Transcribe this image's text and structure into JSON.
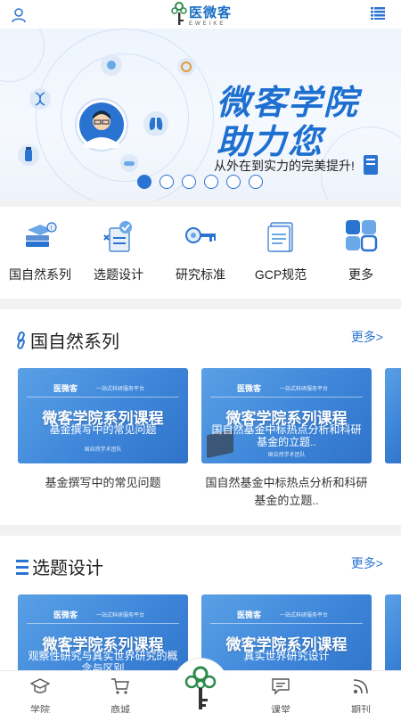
{
  "header": {
    "logo_text": "医微客",
    "logo_sub": "EWEIKE"
  },
  "banner": {
    "title_line1": "微客学院",
    "title_line2": "助力您",
    "subtitle": "从外在到实力的完美提升!",
    "slides_total": 6,
    "active_slide": 1
  },
  "quick_entries": [
    {
      "label": "国自然系列",
      "icon": "database-coins-icon"
    },
    {
      "label": "选题设计",
      "icon": "checklist-icon"
    },
    {
      "label": "研究标准",
      "icon": "key-icon"
    },
    {
      "label": "GCP规范",
      "icon": "document-gcp-icon"
    },
    {
      "label": "更多",
      "icon": "grid-more-icon"
    }
  ],
  "sections": [
    {
      "title": "国自然系列",
      "more": "更多>",
      "cards": [
        {
          "brand": "医微客",
          "tagline": "一站式科研服务平台",
          "course": "微客学院系列课程",
          "topic": "基金撰写中的常见问题",
          "team": "国自然学术团队",
          "caption": "基金撰写中的常见问题"
        },
        {
          "brand": "医微客",
          "tagline": "一站式科研服务平台",
          "course": "微客学院系列课程",
          "topic": "国自然基金中标热点分析和科研基金的立题..",
          "team": "国自然学术团队",
          "caption": "国自然基金中标热点分析和科研基金的立题.."
        }
      ]
    },
    {
      "title": "选题设计",
      "more": "更多>",
      "cards": [
        {
          "brand": "医微客",
          "tagline": "一站式科研服务平台",
          "course": "微客学院系列课程",
          "topic": "观察性研究与真实世界研究的概念与区别"
        },
        {
          "brand": "医微客",
          "tagline": "一站式科研服务平台",
          "course": "微客学院系列课程",
          "topic": "真实世界研究设计"
        }
      ]
    }
  ],
  "bottom_nav": [
    {
      "label": "学院",
      "icon": "graduation-cap-icon"
    },
    {
      "label": "商城",
      "icon": "shopping-cart-icon"
    },
    {
      "label": "",
      "icon": "app-logo-icon"
    },
    {
      "label": "课堂",
      "icon": "chat-message-icon"
    },
    {
      "label": "期刊",
      "icon": "rss-icon"
    }
  ],
  "colors": {
    "brand_blue": "#2a73d1",
    "title_blue": "#1d6fd0",
    "card_blue": "#3e86d9",
    "logo_green": "#2c8a4a"
  }
}
